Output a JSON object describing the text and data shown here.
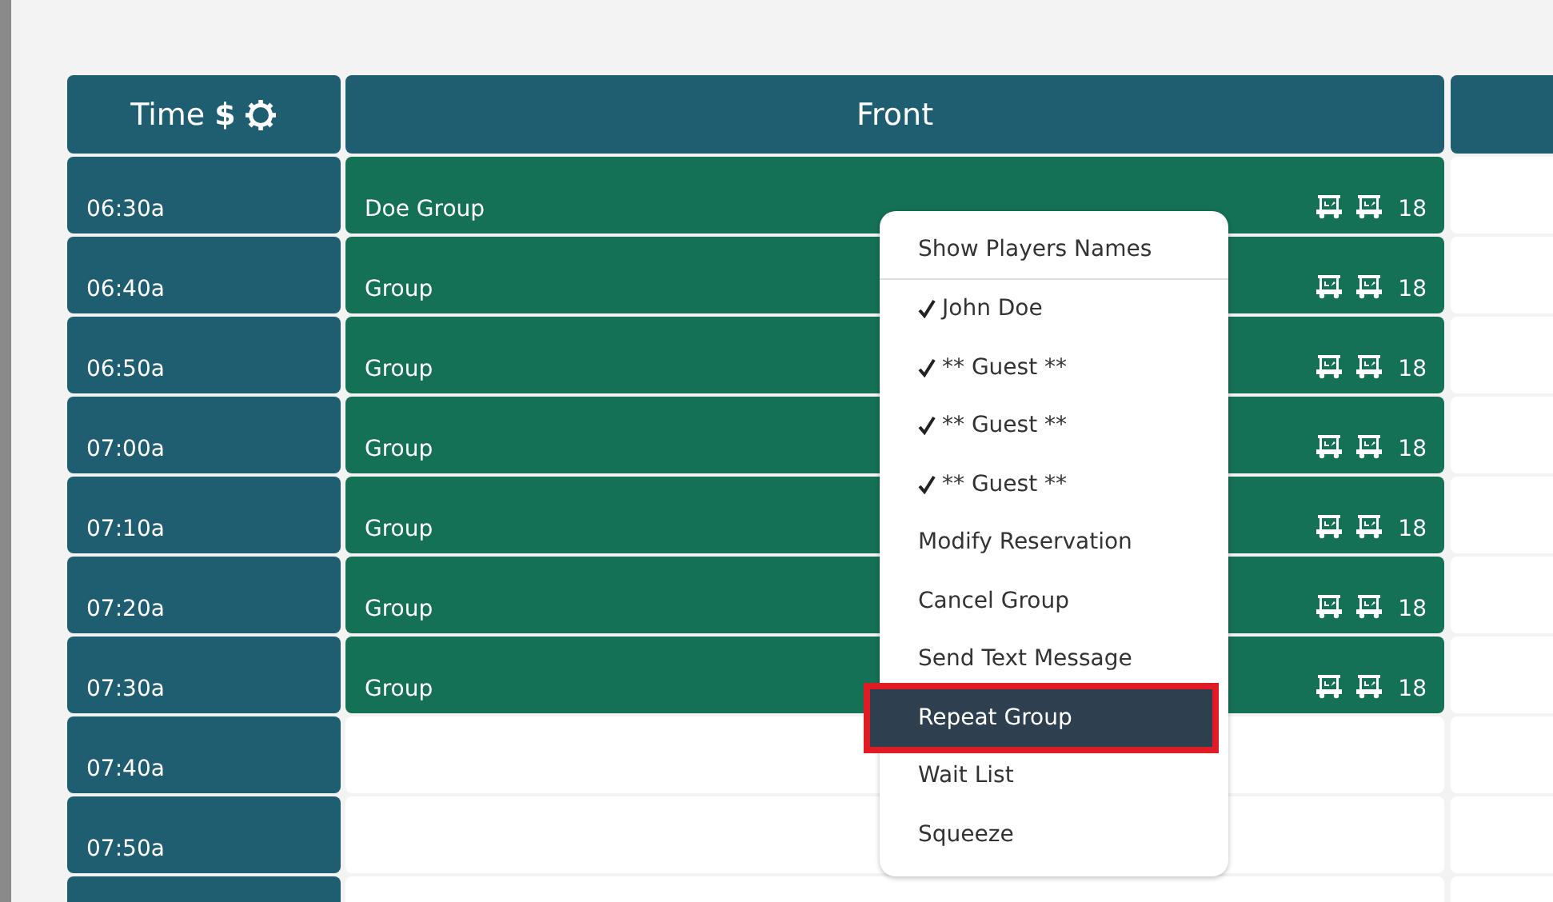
{
  "tee_sheet": {
    "columns": [
      {
        "label": "Time",
        "kind": "time",
        "price_symbol": "$"
      },
      {
        "label": "Front",
        "kind": "course"
      },
      {
        "kind": "cut"
      }
    ],
    "rows": [
      {
        "time": "06:30a",
        "booked": true,
        "group": "Doe Group",
        "holes": "18"
      },
      {
        "time": "06:40a",
        "booked": true,
        "group": "Group",
        "holes": "18"
      },
      {
        "time": "06:50a",
        "booked": true,
        "group": "Group",
        "holes": "18"
      },
      {
        "time": "07:00a",
        "booked": true,
        "group": "Group",
        "holes": "18"
      },
      {
        "time": "07:10a",
        "booked": true,
        "group": "Group",
        "holes": "18"
      },
      {
        "time": "07:20a",
        "booked": true,
        "group": "Group",
        "holes": "18"
      },
      {
        "time": "07:30a",
        "booked": true,
        "group": "Group",
        "holes": "18"
      },
      {
        "time": "07:40a",
        "booked": false
      },
      {
        "time": "07:50a",
        "booked": false
      },
      {
        "booked": false
      }
    ]
  },
  "context_menu": {
    "items": [
      {
        "kind": "header",
        "label": "Show Players Names",
        "selected": false
      },
      {
        "kind": "player",
        "label": "John Doe",
        "checked": true,
        "selected": false
      },
      {
        "kind": "player",
        "label": "** Guest **",
        "checked": true,
        "selected": false
      },
      {
        "kind": "player",
        "label": "** Guest **",
        "checked": true,
        "selected": false
      },
      {
        "kind": "player",
        "label": "** Guest **",
        "checked": true,
        "selected": false
      },
      {
        "kind": "action",
        "label": "Modify Reservation",
        "selected": false
      },
      {
        "kind": "action",
        "label": "Cancel Group",
        "selected": false
      },
      {
        "kind": "action",
        "label": "Send Text Message",
        "selected": false
      },
      {
        "kind": "action",
        "label": "Repeat Group",
        "selected": true,
        "highlighted": true
      },
      {
        "kind": "action",
        "label": "Wait List",
        "selected": false
      },
      {
        "kind": "action",
        "label": "Squeeze",
        "selected": false
      }
    ]
  }
}
